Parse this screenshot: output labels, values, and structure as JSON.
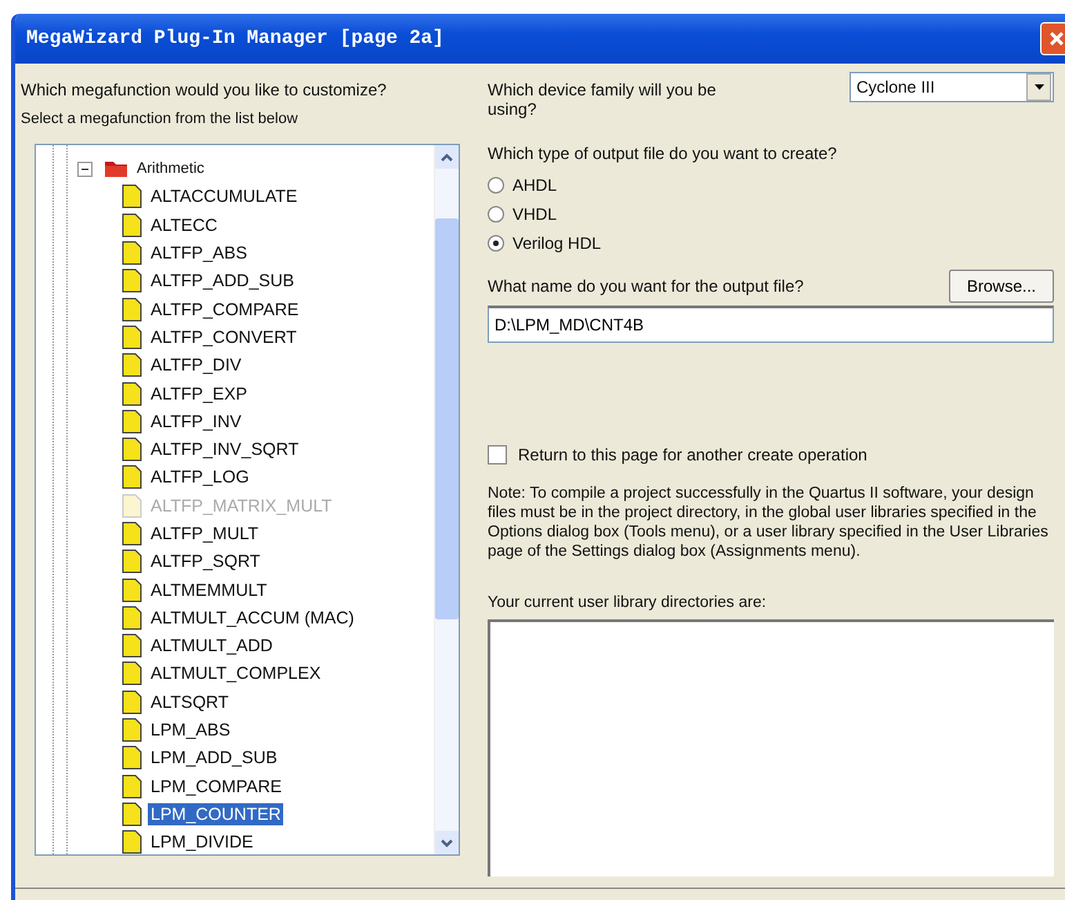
{
  "window": {
    "title": "MegaWizard Plug-In Manager [page 2a]"
  },
  "left": {
    "question": "Which megafunction would you like to customize?",
    "instruction": "Select a megafunction from the list below",
    "tree": [
      {
        "label": "Arithmetic",
        "expanded": true,
        "children": [
          {
            "label": "ALTACCUMULATE",
            "disabled": false,
            "selected": false
          },
          {
            "label": "ALTECC",
            "disabled": false,
            "selected": false
          },
          {
            "label": "ALTFP_ABS",
            "disabled": false,
            "selected": false
          },
          {
            "label": "ALTFP_ADD_SUB",
            "disabled": false,
            "selected": false
          },
          {
            "label": "ALTFP_COMPARE",
            "disabled": false,
            "selected": false
          },
          {
            "label": "ALTFP_CONVERT",
            "disabled": false,
            "selected": false
          },
          {
            "label": "ALTFP_DIV",
            "disabled": false,
            "selected": false
          },
          {
            "label": "ALTFP_EXP",
            "disabled": false,
            "selected": false
          },
          {
            "label": "ALTFP_INV",
            "disabled": false,
            "selected": false
          },
          {
            "label": "ALTFP_INV_SQRT",
            "disabled": false,
            "selected": false
          },
          {
            "label": "ALTFP_LOG",
            "disabled": false,
            "selected": false
          },
          {
            "label": "ALTFP_MATRIX_MULT",
            "disabled": true,
            "selected": false
          },
          {
            "label": "ALTFP_MULT",
            "disabled": false,
            "selected": false
          },
          {
            "label": "ALTFP_SQRT",
            "disabled": false,
            "selected": false
          },
          {
            "label": "ALTMEMMULT",
            "disabled": false,
            "selected": false
          },
          {
            "label": "ALTMULT_ACCUM (MAC)",
            "disabled": false,
            "selected": false
          },
          {
            "label": "ALTMULT_ADD",
            "disabled": false,
            "selected": false
          },
          {
            "label": "ALTMULT_COMPLEX",
            "disabled": false,
            "selected": false
          },
          {
            "label": "ALTSQRT",
            "disabled": false,
            "selected": false
          },
          {
            "label": "LPM_ABS",
            "disabled": false,
            "selected": false
          },
          {
            "label": "LPM_ADD_SUB",
            "disabled": false,
            "selected": false
          },
          {
            "label": "LPM_COMPARE",
            "disabled": false,
            "selected": false
          },
          {
            "label": "LPM_COUNTER",
            "disabled": false,
            "selected": true
          },
          {
            "label": "LPM_DIVIDE",
            "disabled": false,
            "selected": false
          }
        ]
      }
    ]
  },
  "right": {
    "family_label": "Which device family will you be using?",
    "family_value": "Cyclone III",
    "type_label": "Which type of output file do you want to create?",
    "output_types": [
      {
        "label": "AHDL",
        "selected": false
      },
      {
        "label": "VHDL",
        "selected": false
      },
      {
        "label": "Verilog HDL",
        "selected": true
      }
    ],
    "name_label": "What name do you want for the output file?",
    "browse_button": "Browse...",
    "file_name": "D:\\LPM_MD\\CNT4B",
    "return_option": {
      "label": "Return to this page for another create operation",
      "checked": false
    },
    "note": "Note: To compile a project successfully in the Quartus II software, your design files must be in the project directory, in the global user libraries specified in the Options dialog box (Tools menu), or a user library specified in the User Libraries page of the Settings dialog box (Assignments menu).",
    "libraries_label": "Your current user library directories are:"
  }
}
